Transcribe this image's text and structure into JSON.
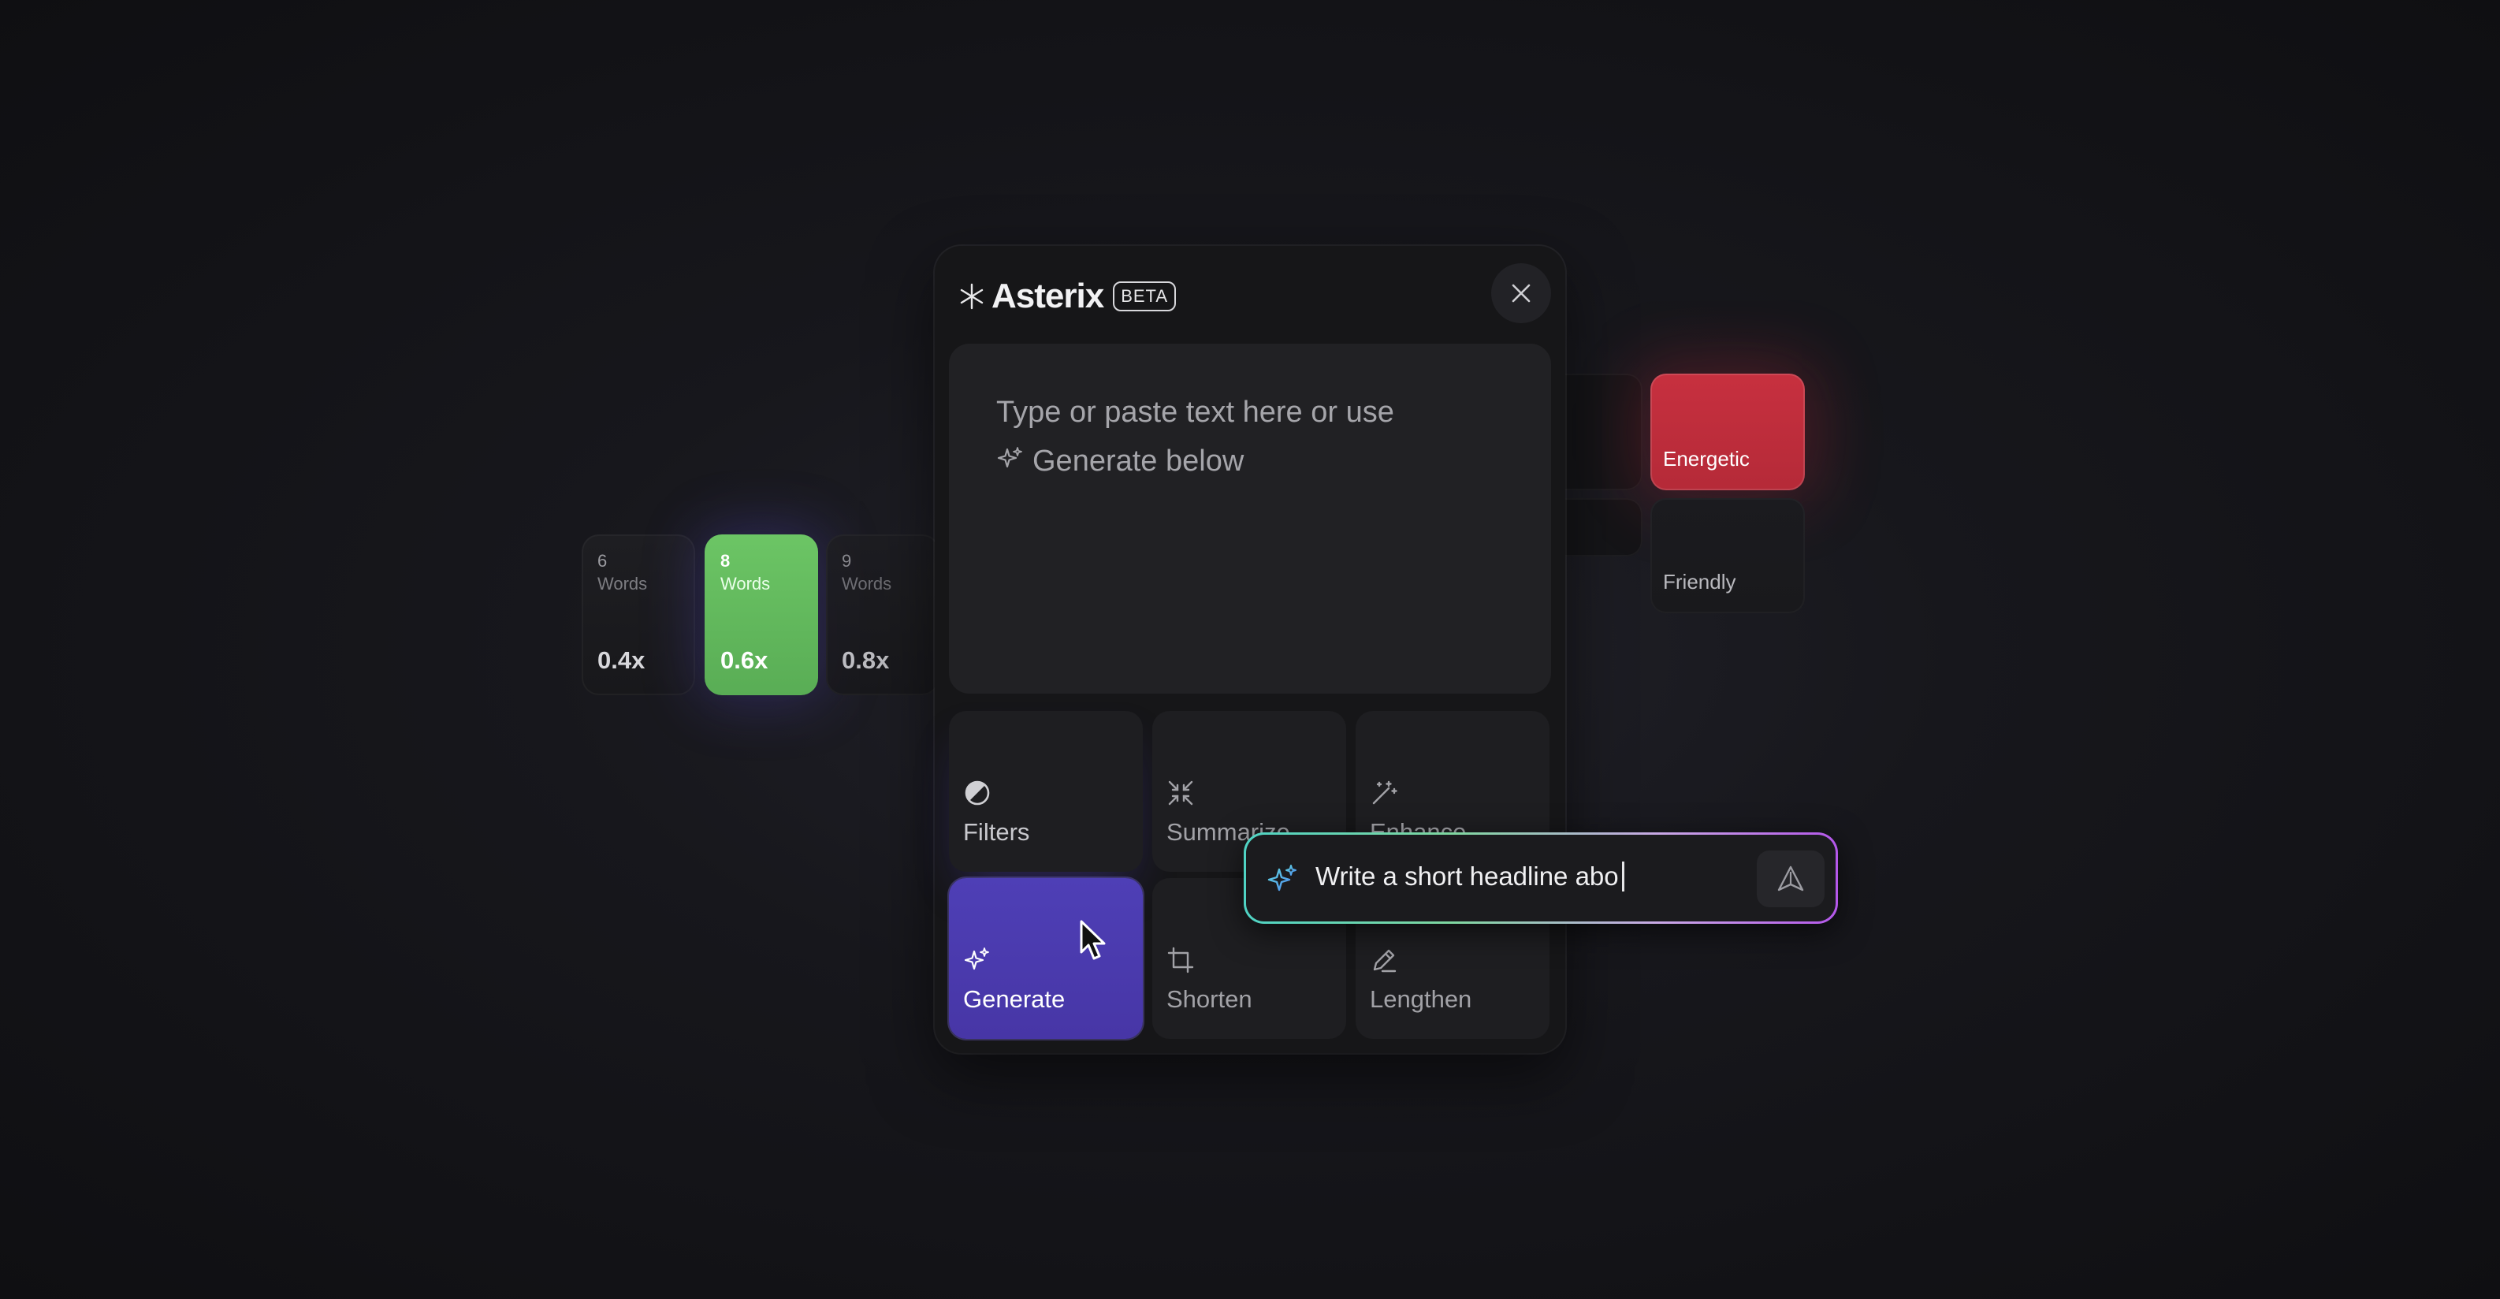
{
  "app": {
    "title": "Asterix",
    "badge": "BETA"
  },
  "editor": {
    "placeholder_line1": "Type or paste text here or use",
    "placeholder_line2": "Generate below"
  },
  "tools": [
    {
      "label": "Filters",
      "icon": "contrast-icon"
    },
    {
      "label": "Summarize",
      "icon": "minimize-arrows-icon"
    },
    {
      "label": "Enhance",
      "icon": "magic-wand-icon"
    },
    {
      "label": "Generate",
      "icon": "sparkles-icon"
    },
    {
      "label": "Shorten",
      "icon": "crop-icon"
    },
    {
      "label": "Lengthen",
      "icon": "pencil-icon"
    }
  ],
  "word_options": [
    {
      "count": "6",
      "unit": "Words",
      "multiplier": "0.4x"
    },
    {
      "count": "8",
      "unit": "Words",
      "multiplier": "0.6x",
      "selected": true
    },
    {
      "count": "9",
      "unit": "Words",
      "multiplier": "0.8x"
    }
  ],
  "tones": [
    {
      "label": "Energetic",
      "selected": true
    },
    {
      "label": "Friendly"
    }
  ],
  "prompt": {
    "value": "Write a short headline abo"
  },
  "colors": {
    "generate_accent": "#4e3fb6",
    "word_selected": "#6cc565",
    "tone_selected": "#c7303f"
  }
}
